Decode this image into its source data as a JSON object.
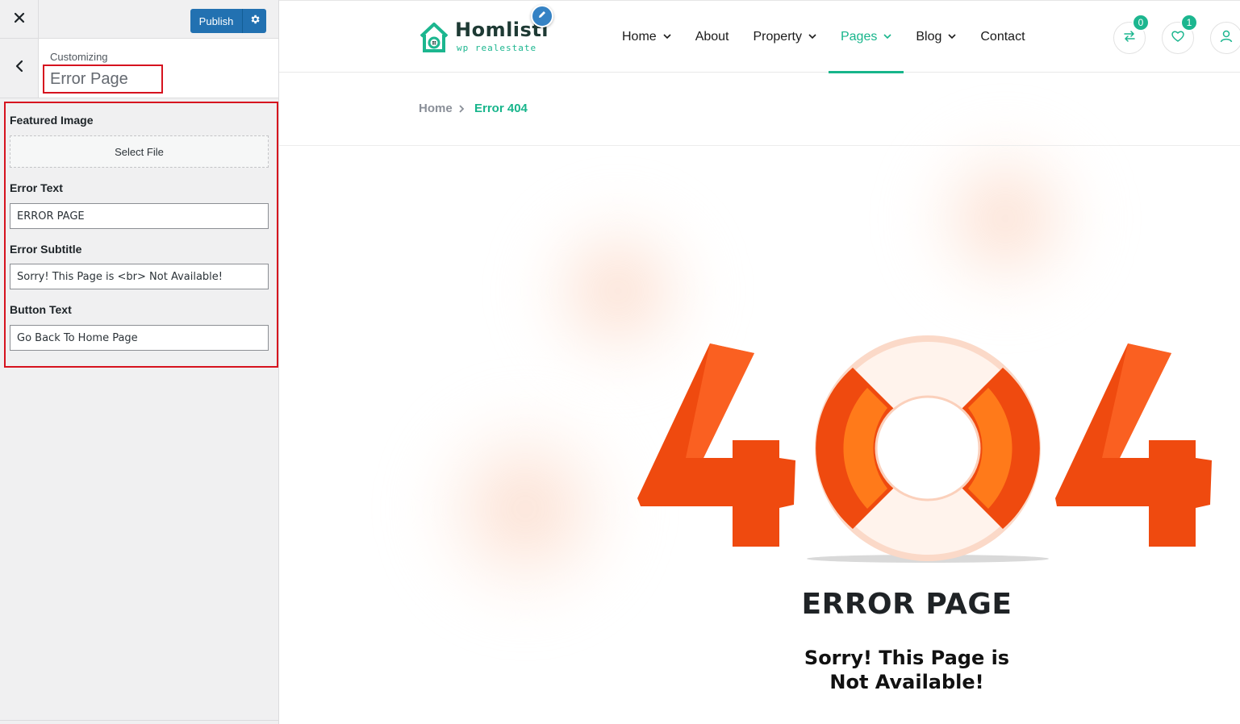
{
  "customizer": {
    "publish_label": "Publish",
    "customizing_label": "Customizing",
    "section_title": "Error Page",
    "controls": {
      "featured_image_label": "Featured Image",
      "select_file_label": "Select File",
      "error_text_label": "Error Text",
      "error_text_value": "ERROR PAGE",
      "error_subtitle_label": "Error Subtitle",
      "error_subtitle_value": "Sorry! This Page is <br> Not Available!",
      "button_text_label": "Button Text",
      "button_text_value": "Go Back To Home Page"
    }
  },
  "site": {
    "logo": {
      "name": "Homlisti",
      "tagline": "wp realestate"
    },
    "nav": [
      {
        "label": "Home",
        "has_dropdown": true,
        "active": false
      },
      {
        "label": "About",
        "has_dropdown": false,
        "active": false
      },
      {
        "label": "Property",
        "has_dropdown": true,
        "active": false
      },
      {
        "label": "Pages",
        "has_dropdown": true,
        "active": true
      },
      {
        "label": "Blog",
        "has_dropdown": true,
        "active": false
      },
      {
        "label": "Contact",
        "has_dropdown": false,
        "active": false
      }
    ],
    "header_icons": {
      "compare_count": "0",
      "favorites_count": "1"
    },
    "breadcrumb": {
      "home": "Home",
      "current": "Error 404"
    },
    "error": {
      "graphic_text": "404",
      "title": "ERROR PAGE",
      "subtitle_line1": "Sorry! This Page is",
      "subtitle_line2": "Not Available!"
    }
  },
  "colors": {
    "accent": "#17b58b",
    "wp_blue": "#2271b1",
    "highlight_red": "#d6131f",
    "error_orange": "#ef4a0f"
  }
}
